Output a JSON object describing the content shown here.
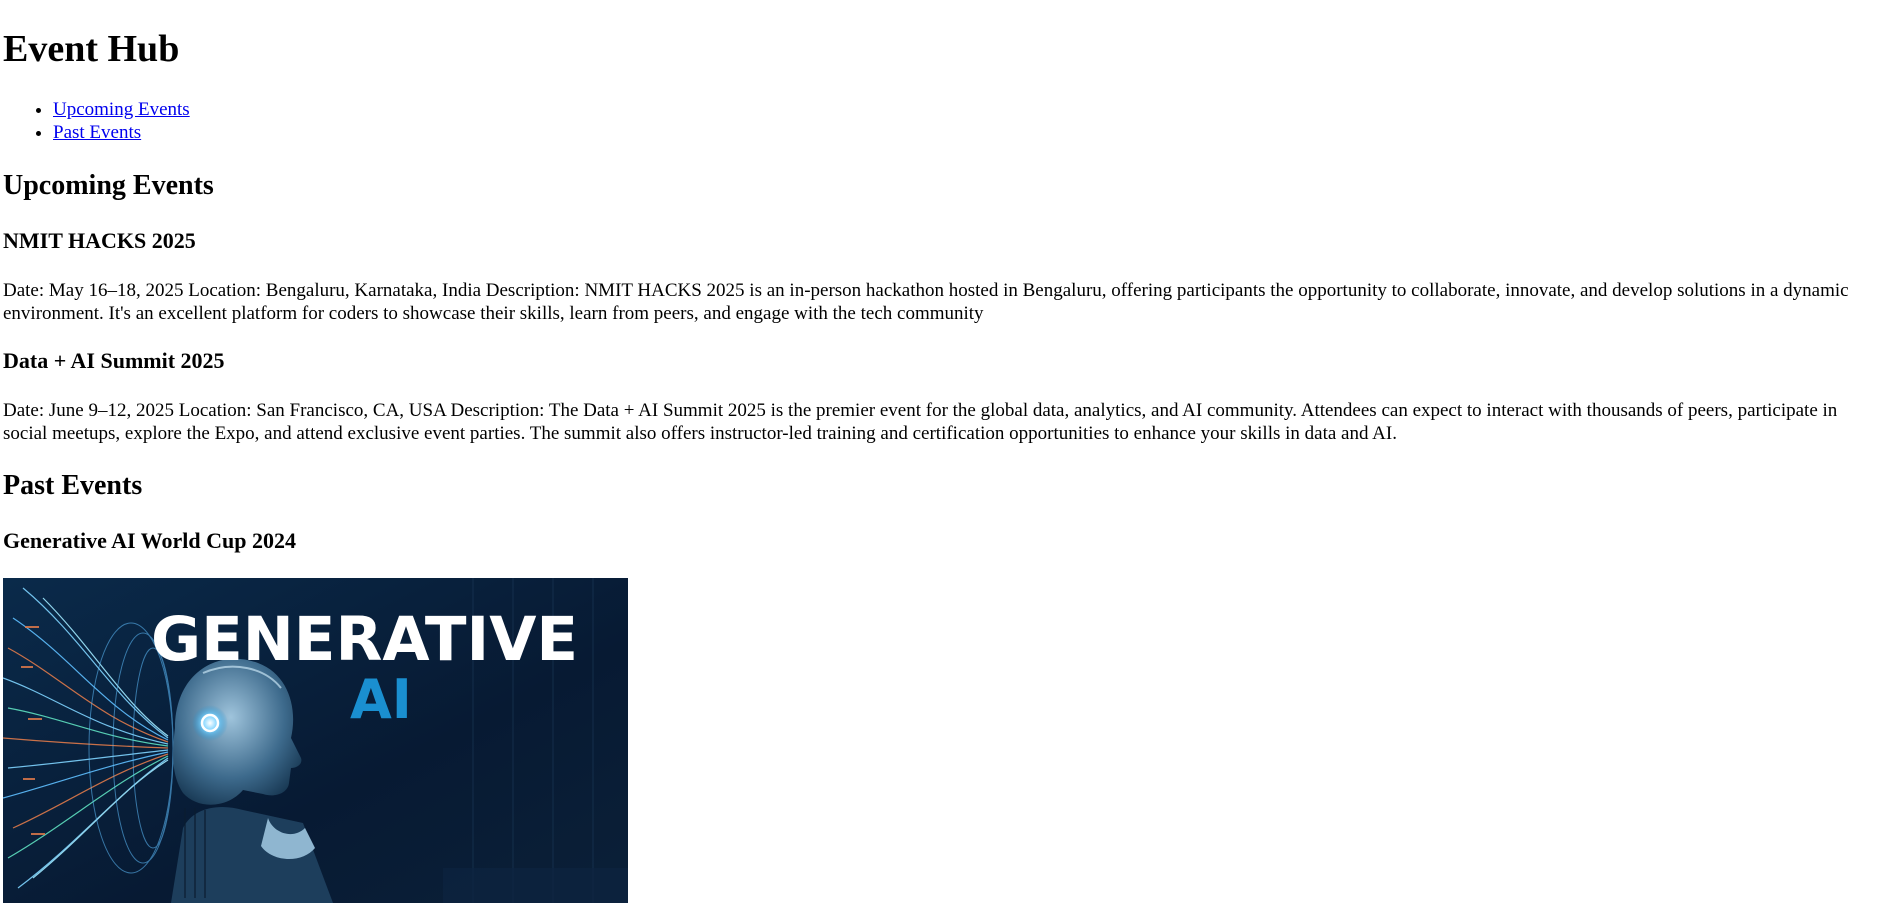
{
  "site": {
    "title": "Event Hub"
  },
  "nav": {
    "items": [
      {
        "label": "Upcoming Events"
      },
      {
        "label": "Past Events"
      }
    ]
  },
  "upcoming": {
    "heading": "Upcoming Events",
    "events": [
      {
        "title": "NMIT HACKS 2025",
        "details": "Date: May 16–18, 2025 Location: Bengaluru, Karnataka, India Description: NMIT HACKS 2025 is an in-person hackathon hosted in Bengaluru, offering participants the opportunity to collaborate, innovate, and develop solutions in a dynamic environment. It's an excellent platform for coders to showcase their skills, learn from peers, and engage with the tech community"
      },
      {
        "title": "Data + AI Summit 2025",
        "details": "Date: June 9–12, 2025 Location: San Francisco, CA, USA Description: The Data + AI Summit 2025 is the premier event for the global data, analytics, and AI community. Attendees can expect to interact with thousands of peers, participate in social meetups, explore the Expo, and attend exclusive event parties. The summit also offers instructor-led training and certification opportunities to enhance your skills in data and AI."
      }
    ]
  },
  "past": {
    "heading": "Past Events",
    "events": [
      {
        "title": "Generative AI World Cup 2024",
        "image": {
          "line1": "GENERATIVE",
          "line2": "AI"
        }
      }
    ]
  },
  "colors": {
    "link": "#0000ee",
    "image_bg": "#06172d",
    "image_accent": "#1a8fd0"
  }
}
